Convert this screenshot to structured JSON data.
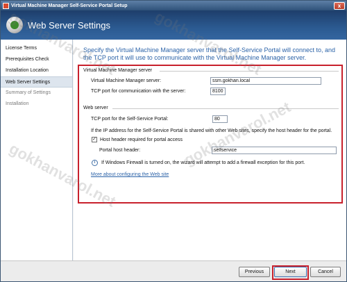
{
  "window": {
    "title": "Virtual Machine Manager Self-Service Portal Setup",
    "close_glyph": "x"
  },
  "header": {
    "title": "Web Server Settings"
  },
  "sidebar": {
    "items": [
      {
        "label": "License Terms",
        "state": "normal"
      },
      {
        "label": "Prerequisites Check",
        "state": "normal"
      },
      {
        "label": "Installation Location",
        "state": "normal"
      },
      {
        "label": "Web Server Settings",
        "state": "active"
      },
      {
        "label": "Summary of Settings",
        "state": "disabled"
      },
      {
        "label": "Installation",
        "state": "disabled"
      }
    ]
  },
  "main": {
    "intro": "Specify the Virtual Machine Manager server that the Self-Service Portal will connect to, and the TCP port it will use to communicate with the Virtual Machine Manager server.",
    "vmm_section": {
      "title": "Virtual Machine Manager server",
      "server_label": "Virtual Machine Manager server:",
      "server_value": "ssm.gokhan.local",
      "port_label": "TCP port for communication with the server:",
      "port_value": "8100"
    },
    "web_section": {
      "title": "Web server",
      "port_label": "TCP port for the Self-Service Portal:",
      "port_value": "80",
      "shared_note": "If the IP address for the Self-Service Portal is shared with other Web sites, specify the host header for the portal.",
      "host_header_checkbox_label": "Host header required for portal access",
      "host_header_checked": true,
      "check_glyph": "✓",
      "host_header_label": "Portal host header:",
      "host_header_value": "selfservice",
      "firewall_note": "If Windows Firewall is turned on, the wizard will attempt to add a firewall exception for this port.",
      "info_glyph": "i",
      "more_link": "More about configuring the Web site"
    }
  },
  "footer": {
    "previous_label": "Previous",
    "next_label": "Next",
    "cancel_label": "Cancel"
  },
  "watermark": {
    "text": "gokhanvarol.net"
  },
  "colors": {
    "accent": "#2c63a8",
    "highlight": "#c8202c",
    "header": "#2b5a91"
  }
}
